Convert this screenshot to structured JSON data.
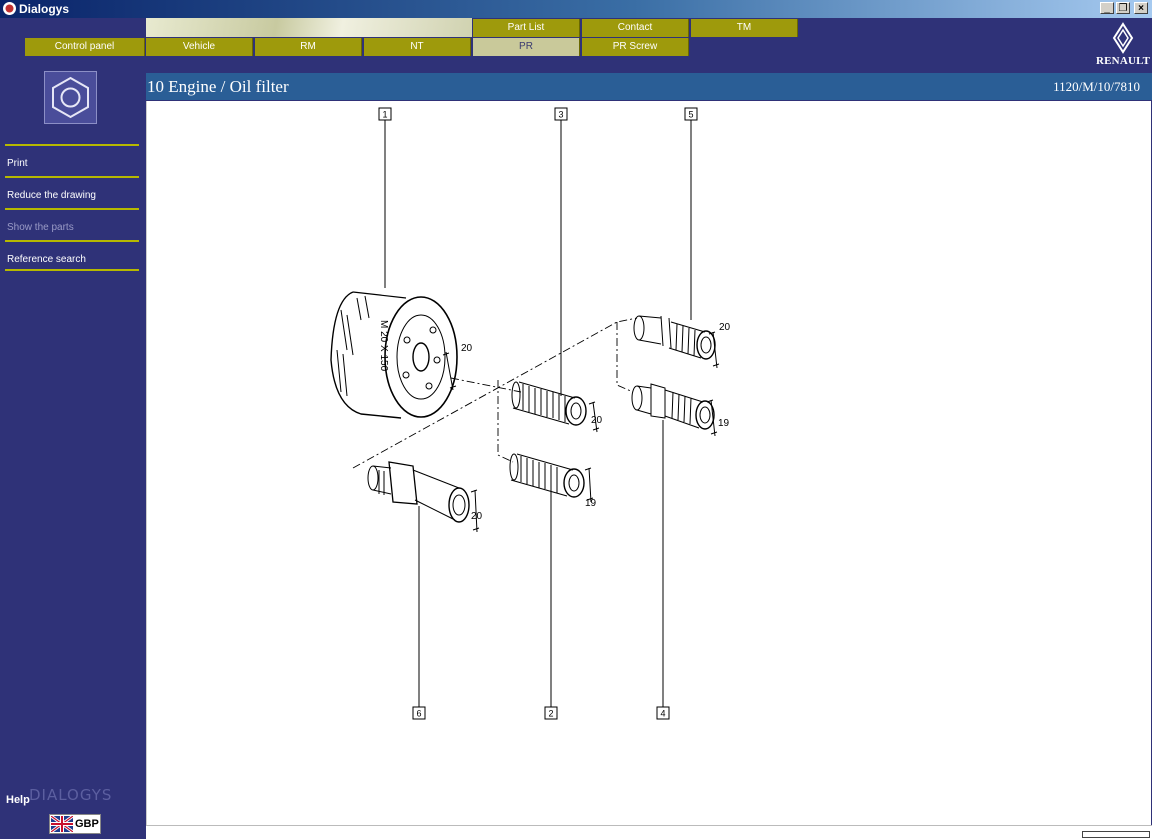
{
  "window": {
    "title": "Dialogys",
    "controls": [
      "_",
      "❐",
      "×"
    ]
  },
  "nav_top": [
    {
      "label": "Part List"
    },
    {
      "label": "Contact"
    },
    {
      "label": "TM"
    }
  ],
  "nav_bottom": [
    {
      "label": "Control panel"
    },
    {
      "label": "Vehicle"
    },
    {
      "label": "RM"
    },
    {
      "label": "NT"
    },
    {
      "label": "PR"
    },
    {
      "label": "PR Screw"
    }
  ],
  "brand": {
    "name": "RENAULT"
  },
  "sidebar": {
    "items": [
      {
        "label": "Print"
      },
      {
        "label": "Reduce the drawing"
      },
      {
        "label": "Show the parts"
      },
      {
        "label": "Reference search"
      }
    ],
    "help": "Help",
    "watermark": "DIALOGYS",
    "currency": "GBP"
  },
  "page": {
    "title": "10 Engine / Oil filter",
    "reference": "1120/M/10/7810"
  },
  "drawing": {
    "callouts": [
      "1",
      "3",
      "5",
      "6",
      "2",
      "4"
    ],
    "dimensions": [
      "20",
      "20",
      "20",
      "19",
      "20",
      "19"
    ],
    "filter_marking": "M 20 X 150"
  },
  "colors": {
    "background": "#2f3278",
    "nav_button": "#9e9a0c",
    "nav_active": "#c9c99a",
    "separator": "#b6b800",
    "header": "#2a5e96"
  }
}
